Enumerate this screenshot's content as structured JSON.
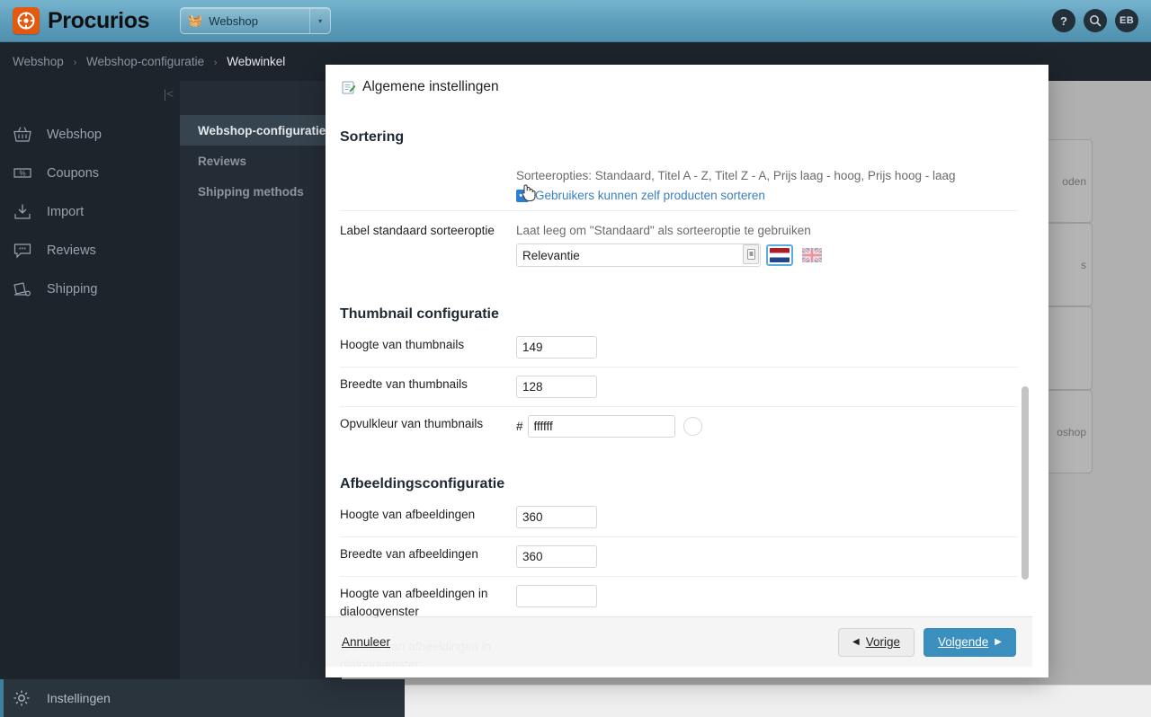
{
  "app": {
    "brand": "Procurios",
    "site_selector": {
      "label": "Webshop",
      "icon": "basket-icon",
      "caret": "▾"
    },
    "top_icons": {
      "help": "?",
      "search": "search-icon",
      "avatar_initials": "EB"
    },
    "accent_color": "#3b8fbf",
    "brand_color": "#e2590f"
  },
  "breadcrumb": {
    "items": [
      "Webshop",
      "Webshop-configuratie",
      "Webwinkel"
    ],
    "separator": "›"
  },
  "sidebar": {
    "collapse_icon": "chevron-left-icon",
    "items": [
      {
        "label": "Webshop",
        "icon": "basket-icon"
      },
      {
        "label": "Coupons",
        "icon": "coupon-icon"
      },
      {
        "label": "Import",
        "icon": "import-icon"
      },
      {
        "label": "Reviews",
        "icon": "comment-icon"
      },
      {
        "label": "Shipping",
        "icon": "shipping-cart-icon"
      }
    ],
    "bottom_item": {
      "label": "Instellingen",
      "icon": "gear-icon"
    }
  },
  "subnav": {
    "items": [
      {
        "label": "Webshop-configuratie",
        "active": true
      },
      {
        "label": "Reviews",
        "active": false
      },
      {
        "label": "Shipping methods",
        "active": false
      }
    ]
  },
  "background_cards": [
    {
      "text": "oden"
    },
    {
      "text": ""
    },
    {
      "text": "s"
    },
    {
      "text": ""
    },
    {
      "text": ""
    },
    {
      "text": "oshop"
    }
  ],
  "modal": {
    "title": "Algemene instellingen",
    "title_icon": "edit-note-icon",
    "close_icon": "close-icon",
    "sections": [
      {
        "heading": "Sortering",
        "rows": [
          {
            "label": "",
            "hint": "Sorteeropties: Standaard, Titel A - Z, Titel Z - A, Prijs laag - hoog, Prijs hoog - laag",
            "checkbox": {
              "label": "Gebruikers kunnen zelf producten sorteren",
              "checked": true
            }
          },
          {
            "label": "Label standaard sorteeroptie",
            "hint": "Laat leeg om \"Standaard\" als sorteeroptie te gebruiken",
            "value": "Relevantie",
            "languages": [
              {
                "name": "nl",
                "selected": true
              },
              {
                "name": "en",
                "selected": false
              }
            ]
          }
        ]
      },
      {
        "heading": "Thumbnail configuratie",
        "rows": [
          {
            "label": "Hoogte van thumbnails",
            "value": "149"
          },
          {
            "label": "Breedte van thumbnails",
            "value": "128"
          },
          {
            "label": "Opvulkleur van thumbnails",
            "prefix": "#",
            "value": "ffffff",
            "swatch": "#ffffff"
          }
        ]
      },
      {
        "heading": "Afbeeldingsconfiguratie",
        "rows": [
          {
            "label": "Hoogte van afbeeldingen",
            "value": "360"
          },
          {
            "label": "Breedte van afbeeldingen",
            "value": "360"
          },
          {
            "label": "Hoogte van afbeeldingen in dialoogvenster",
            "value": ""
          },
          {
            "label": "Breedte van afbeeldingen in dialoogvenster",
            "value": ""
          }
        ]
      }
    ],
    "footer": {
      "cancel_label": "Annuleer",
      "prev_label": "Vorige",
      "prev_icon": "◀",
      "next_label": "Volgende",
      "next_icon": "▶"
    }
  }
}
